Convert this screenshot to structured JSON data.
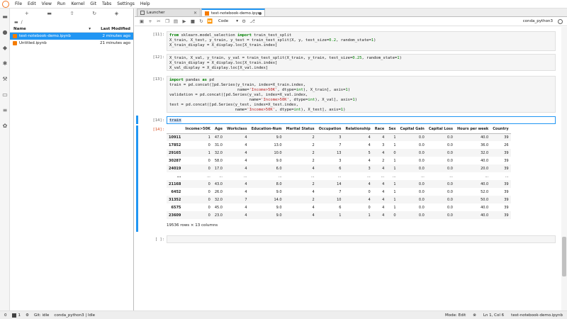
{
  "menubar": {
    "items": [
      "File",
      "Edit",
      "View",
      "Run",
      "Kernel",
      "Git",
      "Tabs",
      "Settings",
      "Help"
    ]
  },
  "filebrowser": {
    "breadcrumb": "/",
    "header_name": "Name",
    "header_modified": "Last Modified",
    "files": [
      {
        "name": "test-notebook-demo.ipynb",
        "modified": "2 minutes ago"
      },
      {
        "name": "Untitled.ipynb",
        "modified": "21 minutes ago"
      }
    ]
  },
  "tabs": [
    {
      "label": "Launcher"
    },
    {
      "label": "test-notebook-demo.ipynb"
    }
  ],
  "toolbar": {
    "cell_type": "Code",
    "kernel": "conda_python3"
  },
  "cells": {
    "c11": {
      "prompt": "[11]:"
    },
    "c12": {
      "prompt": "[12]:"
    },
    "c13": {
      "prompt": "[13]:"
    },
    "c14": {
      "prompt": "[14]:",
      "code": "train",
      "out_prompt": "[14]:"
    },
    "empty": {
      "prompt": "[ ]:"
    }
  },
  "dataframe": {
    "columns": [
      "Income>50K",
      "Age",
      "Workclass",
      "Education-Num",
      "Marital Status",
      "Occupation",
      "Relationship",
      "Race",
      "Sex",
      "Capital Gain",
      "Capital Loss",
      "Hours per week",
      "Country"
    ],
    "rows": [
      [
        "10911",
        "1",
        "47.0",
        "4",
        "9.0",
        "2",
        "3",
        "4",
        "4",
        "1",
        "0.0",
        "0.0",
        "40.0",
        "39"
      ],
      [
        "17852",
        "0",
        "31.0",
        "4",
        "13.0",
        "2",
        "7",
        "4",
        "3",
        "1",
        "0.0",
        "0.0",
        "36.0",
        "26"
      ],
      [
        "29165",
        "1",
        "32.0",
        "4",
        "10.0",
        "2",
        "13",
        "5",
        "4",
        "0",
        "0.0",
        "0.0",
        "32.0",
        "39"
      ],
      [
        "30287",
        "0",
        "58.0",
        "4",
        "9.0",
        "2",
        "3",
        "4",
        "2",
        "1",
        "0.0",
        "0.0",
        "40.0",
        "39"
      ],
      [
        "24019",
        "0",
        "17.0",
        "4",
        "6.0",
        "4",
        "6",
        "3",
        "4",
        "1",
        "0.0",
        "0.0",
        "20.0",
        "39"
      ],
      [
        "...",
        "...",
        "...",
        "...",
        "...",
        "...",
        "...",
        "...",
        "...",
        "...",
        "...",
        "...",
        "...",
        "..."
      ],
      [
        "21168",
        "0",
        "43.0",
        "4",
        "8.0",
        "2",
        "14",
        "4",
        "4",
        "1",
        "0.0",
        "0.0",
        "40.0",
        "39"
      ],
      [
        "6452",
        "0",
        "26.0",
        "4",
        "9.0",
        "4",
        "7",
        "0",
        "4",
        "1",
        "0.0",
        "0.0",
        "52.0",
        "39"
      ],
      [
        "31352",
        "0",
        "32.0",
        "7",
        "14.0",
        "2",
        "10",
        "4",
        "4",
        "1",
        "0.0",
        "0.0",
        "50.0",
        "39"
      ],
      [
        "6575",
        "0",
        "45.0",
        "4",
        "9.0",
        "4",
        "6",
        "0",
        "4",
        "1",
        "0.0",
        "0.0",
        "40.0",
        "39"
      ],
      [
        "23609",
        "0",
        "23.0",
        "4",
        "9.0",
        "4",
        "1",
        "1",
        "4",
        "0",
        "0.0",
        "0.0",
        "40.0",
        "39"
      ]
    ],
    "shape_text": "19536 rows × 13 columns"
  },
  "statusbar": {
    "zero": "0",
    "one": "1",
    "git": "Git: idle",
    "kernel_status": "conda_python3 | Idle",
    "mode": "Mode: Edit",
    "position": "Ln 1, Col 6",
    "filename": "test-notebook-demo.ipynb"
  }
}
